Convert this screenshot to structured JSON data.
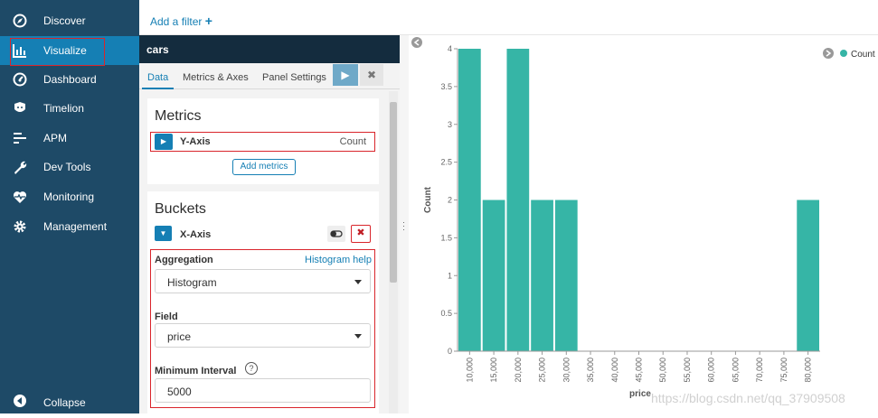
{
  "nav": {
    "items": [
      {
        "label": "Discover",
        "icon": "compass-icon"
      },
      {
        "label": "Visualize",
        "icon": "bar-chart-icon"
      },
      {
        "label": "Dashboard",
        "icon": "dashboard-icon"
      },
      {
        "label": "Timelion",
        "icon": "timelion-icon"
      },
      {
        "label": "APM",
        "icon": "apm-icon"
      },
      {
        "label": "Dev Tools",
        "icon": "wrench-icon"
      },
      {
        "label": "Monitoring",
        "icon": "heartbeat-icon"
      },
      {
        "label": "Management",
        "icon": "gear-icon"
      }
    ],
    "active_index": 1,
    "collapse_label": "Collapse"
  },
  "filterbar": {
    "add_label": "Add a filter",
    "plus": "+"
  },
  "editor": {
    "title": "cars",
    "tabs": [
      "Data",
      "Metrics & Axes",
      "Panel Settings"
    ],
    "active_tab": 0,
    "play": "▶",
    "close": "✖",
    "metrics": {
      "heading": "Metrics",
      "agg_label": "Y-Axis",
      "agg_value": "Count",
      "add_button": "Add metrics"
    },
    "buckets": {
      "heading": "Buckets",
      "agg_label": "X-Axis",
      "aggregation_label": "Aggregation",
      "help_link": "Histogram help",
      "aggregation_value": "Histogram",
      "field_label": "Field",
      "field_value": "price",
      "interval_label": "Minimum Interval",
      "help_icon": "?",
      "interval_value": "5000"
    }
  },
  "colors": {
    "bar": "#36b5a6",
    "nav_bg": "#1e4a67",
    "accent": "#157fb4",
    "highlight": "#d9252b"
  },
  "legend": {
    "label": "Count"
  },
  "chart_data": {
    "type": "bar",
    "categories": [
      "10,000",
      "15,000",
      "20,000",
      "25,000",
      "30,000",
      "35,000",
      "40,000",
      "45,000",
      "50,000",
      "55,000",
      "60,000",
      "65,000",
      "70,000",
      "75,000",
      "80,000"
    ],
    "values": [
      4,
      2,
      4,
      2,
      2,
      0,
      0,
      0,
      0,
      0,
      0,
      0,
      0,
      0,
      2
    ],
    "yticks": [
      "0",
      "0.5",
      "1",
      "1.5",
      "2",
      "2.5",
      "3",
      "3.5",
      "4"
    ],
    "ylim": [
      0,
      4
    ],
    "xlabel": "price",
    "ylabel": "Count",
    "series": [
      {
        "name": "Count",
        "values": [
          4,
          2,
          4,
          2,
          2,
          0,
          0,
          0,
          0,
          0,
          0,
          0,
          0,
          0,
          2
        ]
      }
    ],
    "legend_position": "top-right"
  },
  "watermark": "https://blog.csdn.net/qq_37909508"
}
